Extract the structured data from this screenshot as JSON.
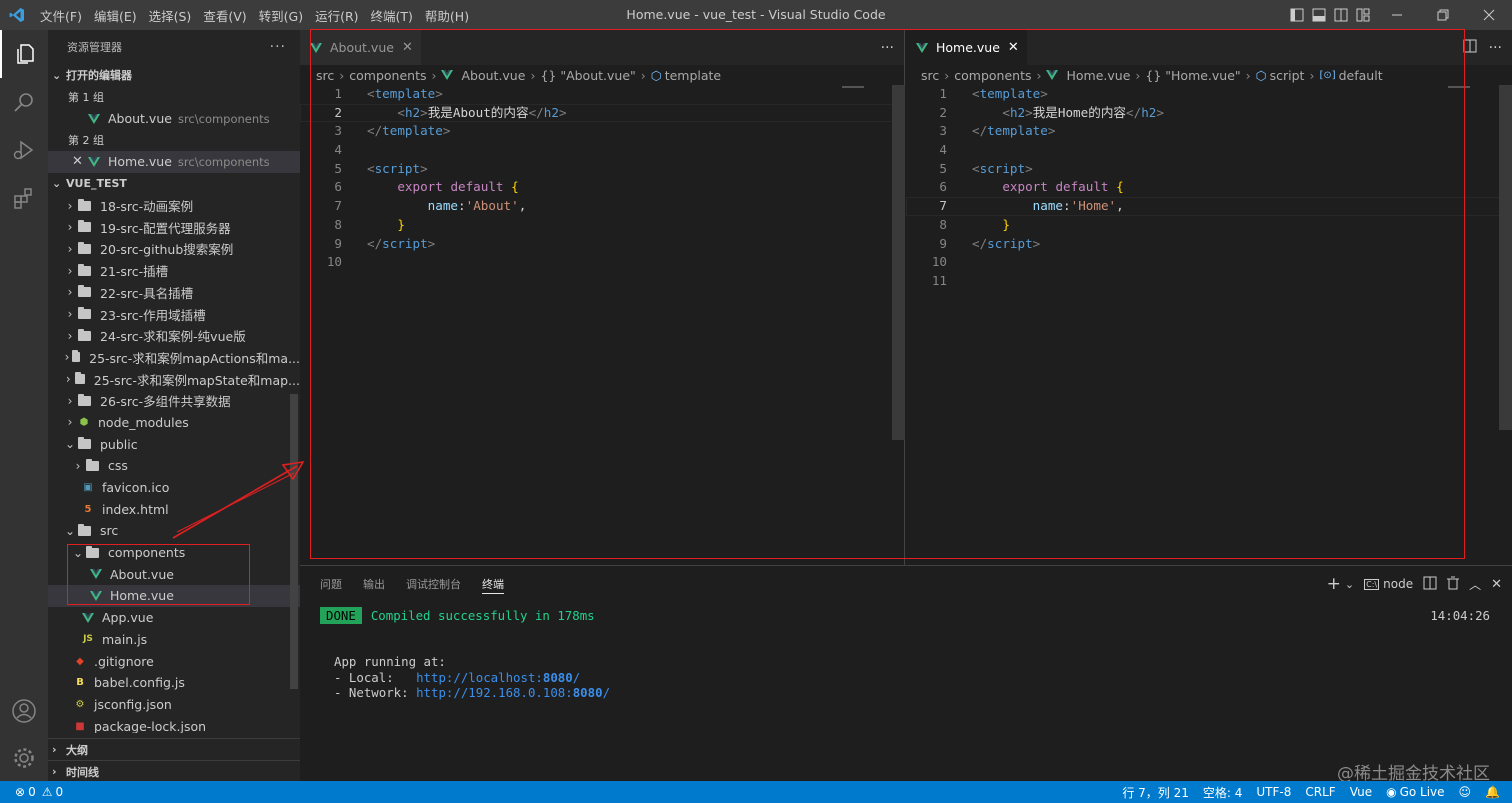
{
  "window": {
    "title": "Home.vue - vue_test - Visual Studio Code",
    "menu": [
      "文件(F)",
      "编辑(E)",
      "选择(S)",
      "查看(V)",
      "转到(G)",
      "运行(R)",
      "终端(T)",
      "帮助(H)"
    ]
  },
  "activity_bar": {
    "icons": [
      "explorer-icon",
      "search-icon",
      "run-debug-icon",
      "extensions-icon",
      "account-icon",
      "gear-icon"
    ]
  },
  "sidebar": {
    "title": "资源管理器",
    "open_editors": {
      "label": "打开的编辑器",
      "group1": "第 1 组",
      "group1_file": {
        "name": "About.vue",
        "path": "src\\components"
      },
      "group2": "第 2 组",
      "group2_file": {
        "name": "Home.vue",
        "path": "src\\components"
      }
    },
    "project": {
      "label": "VUE_TEST",
      "items": [
        {
          "name": "18-src-动画案例",
          "type": "folder",
          "indent": 0,
          "open": false
        },
        {
          "name": "19-src-配置代理服务器",
          "type": "folder",
          "indent": 0,
          "open": false
        },
        {
          "name": "20-src-github搜索案例",
          "type": "folder",
          "indent": 0,
          "open": false
        },
        {
          "name": "21-src-插槽",
          "type": "folder",
          "indent": 0,
          "open": false
        },
        {
          "name": "22-src-具名插槽",
          "type": "folder",
          "indent": 0,
          "open": false
        },
        {
          "name": "23-src-作用域插槽",
          "type": "folder",
          "indent": 0,
          "open": false
        },
        {
          "name": "24-src-求和案例-纯vue版",
          "type": "folder",
          "indent": 0,
          "open": false
        },
        {
          "name": "25-src-求和案例mapActions和ma...",
          "type": "folder",
          "indent": 0,
          "open": false
        },
        {
          "name": "25-src-求和案例mapState和map...",
          "type": "folder",
          "indent": 0,
          "open": false
        },
        {
          "name": "26-src-多组件共享数据",
          "type": "folder",
          "indent": 0,
          "open": false
        },
        {
          "name": "node_modules",
          "type": "nodemod",
          "indent": 0,
          "open": false
        },
        {
          "name": "public",
          "type": "folder",
          "indent": 0,
          "open": true
        },
        {
          "name": "css",
          "type": "folder",
          "indent": 1,
          "open": false
        },
        {
          "name": "favicon.ico",
          "type": "ico",
          "indent": 1
        },
        {
          "name": "index.html",
          "type": "html",
          "indent": 1
        },
        {
          "name": "src",
          "type": "folder",
          "indent": 0,
          "open": true
        },
        {
          "name": "components",
          "type": "folder",
          "indent": 1,
          "open": true
        },
        {
          "name": "About.vue",
          "type": "vue",
          "indent": 2
        },
        {
          "name": "Home.vue",
          "type": "vue",
          "indent": 2,
          "selected": true
        },
        {
          "name": "App.vue",
          "type": "vue",
          "indent": 1
        },
        {
          "name": "main.js",
          "type": "js",
          "indent": 1
        },
        {
          "name": ".gitignore",
          "type": "git",
          "indent": 0
        },
        {
          "name": "babel.config.js",
          "type": "babel",
          "indent": 0
        },
        {
          "name": "jsconfig.json",
          "type": "json",
          "indent": 0
        },
        {
          "name": "package-lock.json",
          "type": "npm",
          "indent": 0
        }
      ]
    },
    "outline": "大纲",
    "timeline": "时间线"
  },
  "editor_left": {
    "tab": "About.vue",
    "breadcrumb": [
      "src",
      "components",
      "About.vue",
      "{} \"About.vue\"",
      "template"
    ],
    "current_line": 2,
    "lines": [
      [
        [
          "t-br",
          "<"
        ],
        [
          "t-tag",
          "template"
        ],
        [
          "t-br",
          ">"
        ]
      ],
      [
        [
          "t-txt",
          "    "
        ],
        [
          "t-br",
          "<"
        ],
        [
          "t-tag",
          "h2"
        ],
        [
          "t-br",
          ">"
        ],
        [
          "t-txt",
          "我是About的内容"
        ],
        [
          "t-br",
          "</"
        ],
        [
          "t-tag",
          "h2"
        ],
        [
          "t-br",
          ">"
        ]
      ],
      [
        [
          "t-br",
          "</"
        ],
        [
          "t-tag",
          "template"
        ],
        [
          "t-br",
          ">"
        ]
      ],
      [],
      [
        [
          "t-br",
          "<"
        ],
        [
          "t-tag",
          "script"
        ],
        [
          "t-br",
          ">"
        ]
      ],
      [
        [
          "t-txt",
          "    "
        ],
        [
          "t-kw",
          "export"
        ],
        [
          "t-txt",
          " "
        ],
        [
          "t-kw",
          "default"
        ],
        [
          "t-txt",
          " "
        ],
        [
          "t-brace",
          "{"
        ]
      ],
      [
        [
          "t-txt",
          "        "
        ],
        [
          "t-prop",
          "name"
        ],
        [
          "t-txt",
          ":"
        ],
        [
          "t-str",
          "'About'"
        ],
        [
          "t-txt",
          ","
        ]
      ],
      [
        [
          "t-txt",
          "    "
        ],
        [
          "t-brace",
          "}"
        ]
      ],
      [
        [
          "t-br",
          "</"
        ],
        [
          "t-tag",
          "script"
        ],
        [
          "t-br",
          ">"
        ]
      ],
      []
    ]
  },
  "editor_right": {
    "tab": "Home.vue",
    "breadcrumb": [
      "src",
      "components",
      "Home.vue",
      "{} \"Home.vue\"",
      "script",
      "default"
    ],
    "current_line": 7,
    "lines": [
      [
        [
          "t-br",
          "<"
        ],
        [
          "t-tag",
          "template"
        ],
        [
          "t-br",
          ">"
        ]
      ],
      [
        [
          "t-txt",
          "    "
        ],
        [
          "t-br",
          "<"
        ],
        [
          "t-tag",
          "h2"
        ],
        [
          "t-br",
          ">"
        ],
        [
          "t-txt",
          "我是Home的内容"
        ],
        [
          "t-br",
          "</"
        ],
        [
          "t-tag",
          "h2"
        ],
        [
          "t-br",
          ">"
        ]
      ],
      [
        [
          "t-br",
          "</"
        ],
        [
          "t-tag",
          "template"
        ],
        [
          "t-br",
          ">"
        ]
      ],
      [],
      [
        [
          "t-br",
          "<"
        ],
        [
          "t-tag",
          "script"
        ],
        [
          "t-br",
          ">"
        ]
      ],
      [
        [
          "t-txt",
          "    "
        ],
        [
          "t-kw",
          "export"
        ],
        [
          "t-txt",
          " "
        ],
        [
          "t-kw",
          "default"
        ],
        [
          "t-txt",
          " "
        ],
        [
          "t-brace",
          "{"
        ]
      ],
      [
        [
          "t-txt",
          "        "
        ],
        [
          "t-prop",
          "name"
        ],
        [
          "t-txt",
          ":"
        ],
        [
          "t-str",
          "'Home'"
        ],
        [
          "t-txt",
          ","
        ]
      ],
      [
        [
          "t-txt",
          "    "
        ],
        [
          "t-brace",
          "}"
        ]
      ],
      [
        [
          "t-br",
          "</"
        ],
        [
          "t-tag",
          "script"
        ],
        [
          "t-br",
          ">"
        ]
      ],
      [],
      []
    ]
  },
  "panel": {
    "tabs": [
      "问题",
      "输出",
      "调试控制台",
      "终端"
    ],
    "active_tab": "终端",
    "terminal_name": "node",
    "done_badge": "DONE",
    "compiled": "Compiled successfully in 178ms",
    "time": "14:04:26",
    "app_running": "App running at:",
    "local_label": "- Local:   ",
    "local_url_pre": "http://localhost:",
    "local_port": "8080",
    "local_slash": "/",
    "network_label": "- Network: ",
    "network_url_pre": "http://192.168.0.108:",
    "network_port": "8080",
    "network_slash": "/"
  },
  "statusbar": {
    "errors": "0",
    "warnings": "0",
    "position": "行 7，列 21",
    "spaces": "空格: 4",
    "encoding": "UTF-8",
    "eol": "CRLF",
    "language": "Vue",
    "golive": "Go Live"
  },
  "watermark": "@稀土掘金技术社区",
  "colors": {
    "accent": "#007acc",
    "annotation": "#e02020",
    "vue": "#41b883"
  }
}
